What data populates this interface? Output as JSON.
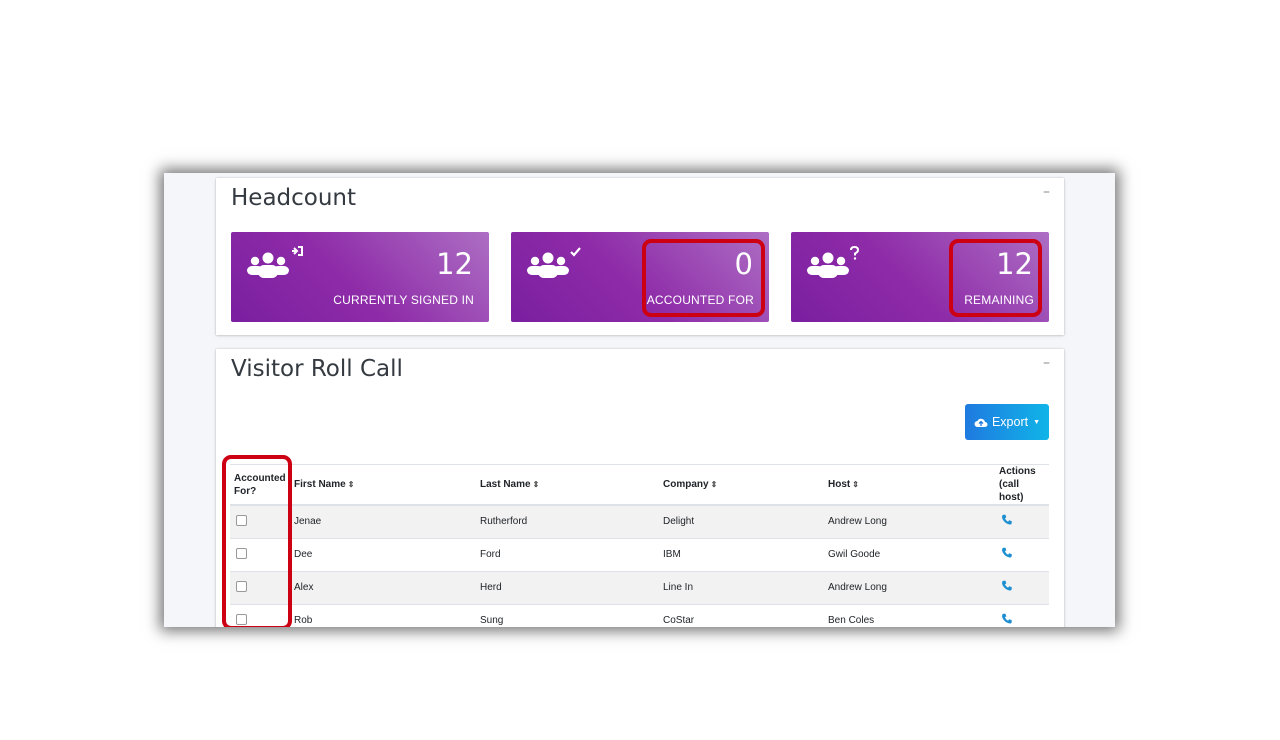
{
  "headcount": {
    "title": "Headcount",
    "collapse": "–",
    "boxes": [
      {
        "count": "12",
        "label": "CURRENTLY SIGNED IN",
        "icon": "users-sign-in-icon"
      },
      {
        "count": "0",
        "label": "ACCOUNTED FOR",
        "icon": "users-check-icon"
      },
      {
        "count": "12",
        "label": "REMAINING",
        "icon": "users-question-icon"
      }
    ]
  },
  "rollcall": {
    "title": "Visitor Roll Call",
    "collapse": "–",
    "export_label": "Export",
    "columns": {
      "accounted_line1": "Accounted",
      "accounted_line2": "For?",
      "first_name": "First Name",
      "last_name": "Last Name",
      "company": "Company",
      "host": "Host",
      "actions_line1": "Actions",
      "actions_line2": "(call host)"
    },
    "sort_glyph": "⇕",
    "rows": [
      {
        "first": "Jenae",
        "last": "Rutherford",
        "company": "Delight",
        "host": "Andrew Long"
      },
      {
        "first": "Dee",
        "last": "Ford",
        "company": "IBM",
        "host": "Gwil Goode"
      },
      {
        "first": "Alex",
        "last": "Herd",
        "company": "Line In",
        "host": "Andrew Long"
      },
      {
        "first": "Rob",
        "last": "Sung",
        "company": "CoStar",
        "host": "Ben Coles"
      }
    ]
  },
  "colors": {
    "box_gradient_start": "#7a1fa0",
    "box_gradient_end": "#ad6fc4",
    "highlight": "#cc0012",
    "export_start": "#1f7ae0",
    "export_end": "#10b4e8",
    "phone": "#1d8fd1"
  }
}
